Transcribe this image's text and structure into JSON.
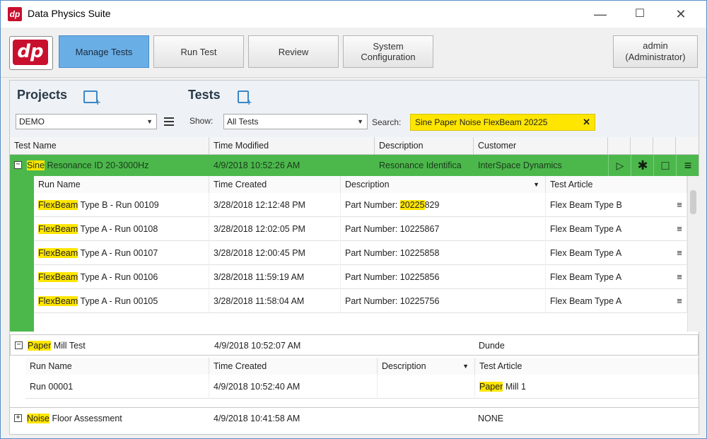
{
  "window": {
    "title": "Data Physics Suite",
    "logo_text": "dp",
    "minimize": "—",
    "maximize": "☐",
    "close": "✕"
  },
  "toolbar": {
    "logo_text": "dp",
    "manage_tests": "Manage Tests",
    "run_test": "Run Test",
    "review": "Review",
    "system_config_line1": "System",
    "system_config_line2": "Configuration",
    "user_name": "admin",
    "user_role": "(Administrator)"
  },
  "projects": {
    "title": "Projects",
    "selected": "DEMO"
  },
  "tests": {
    "title": "Tests",
    "show_label": "Show:",
    "show_value": "All Tests",
    "search_label": "Search:",
    "search_value": "Sine Paper Noise FlexBeam 20225"
  },
  "grid": {
    "headers": {
      "test_name": "Test Name",
      "time_modified": "Time Modified",
      "description": "Description",
      "customer": "Customer"
    }
  },
  "tests_list": [
    {
      "hl": "Sine",
      "rest": " Resonance ID 20-3000Hz",
      "time": "4/9/2018 10:52:26 AM",
      "description": "Resonance Identifica",
      "customer": "InterSpace Dynamics",
      "expander": "−"
    },
    {
      "hl": "Paper",
      "rest": " Mill Test",
      "time": "4/9/2018 10:52:07 AM",
      "description": "",
      "customer": "Dunde",
      "expander": "−"
    },
    {
      "hl": "Noise",
      "rest": " Floor Assessment",
      "time": "4/9/2018 10:41:58 AM",
      "description": "",
      "customer": "NONE",
      "expander": "+"
    }
  ],
  "runs_header": {
    "run_name": "Run Name",
    "time_created": "Time Created",
    "description": "Description",
    "test_article": "Test Article"
  },
  "sine_runs": [
    {
      "hl": "FlexBeam",
      "rest": " Type B - Run 00109",
      "time": "3/28/2018 12:12:48 PM",
      "desc_pre": "Part Number: ",
      "desc_hl": "20225",
      "desc_post": "829",
      "article": "Flex Beam Type B"
    },
    {
      "hl": "FlexBeam",
      "rest": " Type A - Run 00108",
      "time": "3/28/2018 12:02:05 PM",
      "desc_pre": "Part Number: 10225867",
      "desc_hl": "",
      "desc_post": "",
      "article": "Flex Beam Type A"
    },
    {
      "hl": "FlexBeam",
      "rest": " Type A - Run 00107",
      "time": "3/28/2018 12:00:45 PM",
      "desc_pre": "Part Number: 10225858",
      "desc_hl": "",
      "desc_post": "",
      "article": "Flex Beam Type A"
    },
    {
      "hl": "FlexBeam",
      "rest": " Type A - Run 00106",
      "time": "3/28/2018 11:59:19 AM",
      "desc_pre": "Part Number: 10225856",
      "desc_hl": "",
      "desc_post": "",
      "article": "Flex Beam Type A"
    },
    {
      "hl": "FlexBeam",
      "rest": " Type A - Run 00105",
      "time": "3/28/2018 11:58:04 AM",
      "desc_pre": "Part Number: 10225756",
      "desc_hl": "",
      "desc_post": "",
      "article": "Flex Beam Type A"
    }
  ],
  "paper_runs": [
    {
      "run_name": "Run 00001",
      "time": "4/9/2018 10:52:40 AM",
      "description": "",
      "article_hl": "Paper",
      "article_rest": " Mill 1"
    }
  ],
  "icons": {
    "menu": "≡",
    "play": "▷",
    "gear": "✱",
    "folder": "□",
    "dots": "⋮"
  },
  "colors": {
    "selected_row": "#4cb84c",
    "highlight": "#ffe600",
    "active_tab": "#6aaee6",
    "brand": "#c8102e"
  }
}
